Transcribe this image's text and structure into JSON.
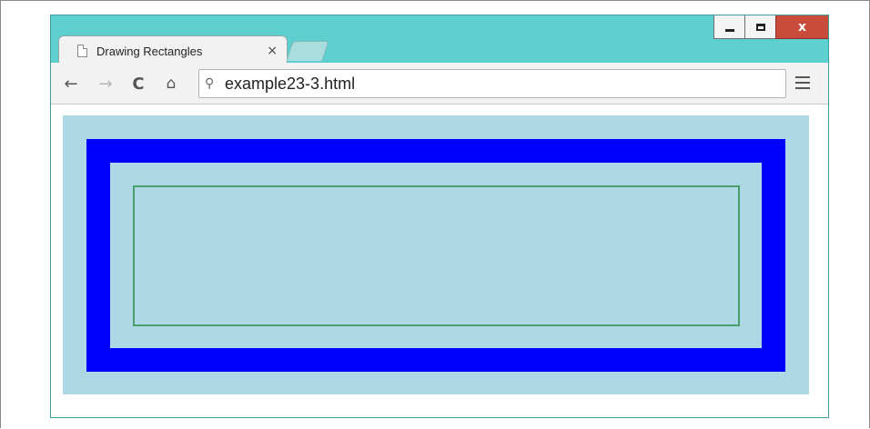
{
  "browser": {
    "tab_title": "Drawing Rectangles",
    "tab_close_glyph": "×",
    "url": "example23-3.html",
    "window_controls": {
      "minimize_icon": "minimize-icon",
      "maximize_icon": "maximize-icon",
      "close_label": "x"
    },
    "nav": {
      "back_glyph": "←",
      "forward_glyph": "→",
      "reload_glyph": "C",
      "home_glyph": "⌂",
      "search_glyph": "⚲"
    },
    "colors": {
      "frame": "#5ecfcf",
      "close_button": "#c94c3a"
    }
  },
  "canvas": {
    "background_color": "#add8e6",
    "blue_rect_color": "#0000ff",
    "green_rect_color": "#4a9e6a",
    "shapes": [
      {
        "kind": "filled-rectangle",
        "color": "light blue"
      },
      {
        "kind": "thick-stroked-rectangle",
        "color": "blue"
      },
      {
        "kind": "thin-stroked-rectangle",
        "color": "green"
      }
    ]
  }
}
